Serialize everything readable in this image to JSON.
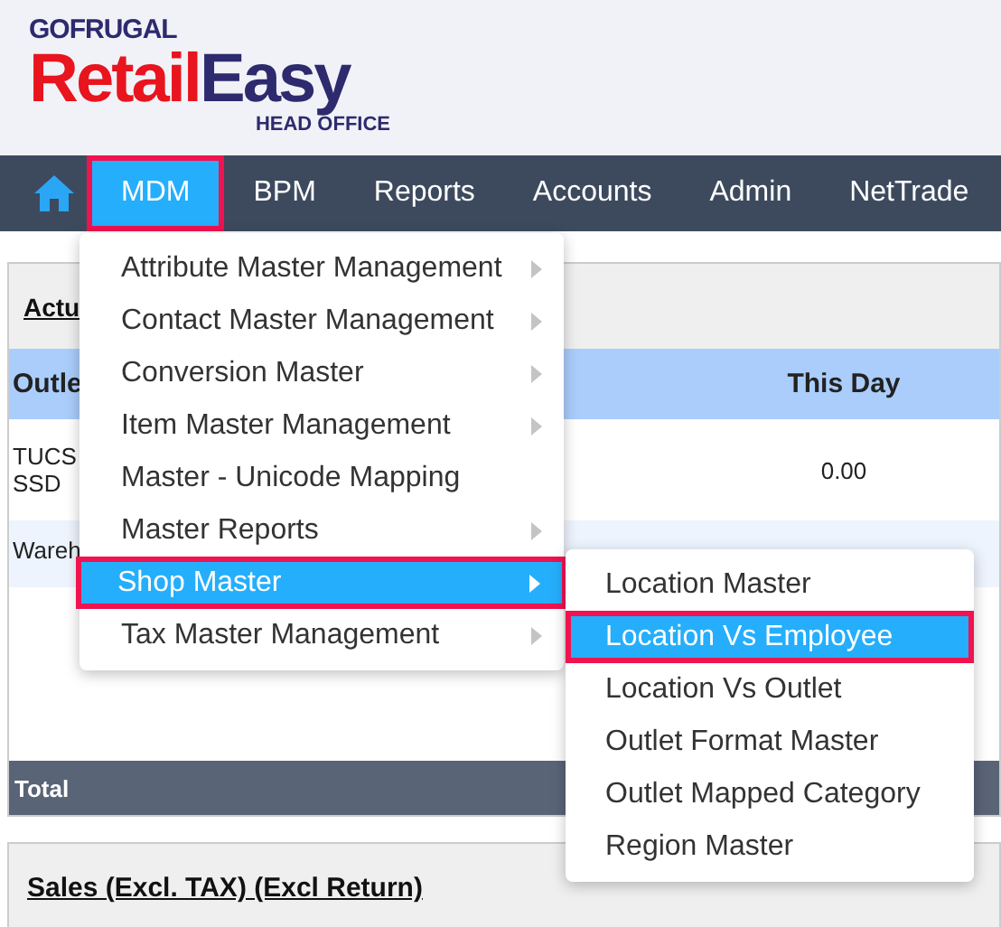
{
  "logo": {
    "brand": "GOFRUGAL",
    "name_part_1": "Retail",
    "name_part_2": "Easy",
    "tagline": "HEAD OFFICE"
  },
  "nav": [
    {
      "label": "MDM",
      "selected": true,
      "outlined": true
    },
    {
      "label": "BPM",
      "selected": false,
      "outlined": false
    },
    {
      "label": "Reports",
      "selected": false,
      "outlined": false
    },
    {
      "label": "Accounts",
      "selected": false,
      "outlined": false
    },
    {
      "label": "Admin",
      "selected": false,
      "outlined": false
    },
    {
      "label": "NetTrade",
      "selected": false,
      "outlined": false
    }
  ],
  "panel": {
    "title": "Actu",
    "columns": [
      "Outle",
      "This Day"
    ],
    "rows": [
      {
        "cells": [
          "TUCS\nSSD",
          "0.00"
        ]
      },
      {
        "cells": [
          "Wareh"
        ]
      }
    ],
    "total_label": "Total"
  },
  "panel_2": {
    "title": "Sales (Excl. TAX) (Excl Return)"
  },
  "menu": [
    {
      "label": "Attribute Master Management",
      "has_submenu": true,
      "selected": false,
      "outlined": false
    },
    {
      "label": "Contact Master Management",
      "has_submenu": true,
      "selected": false,
      "outlined": false
    },
    {
      "label": "Conversion Master",
      "has_submenu": true,
      "selected": false,
      "outlined": false
    },
    {
      "label": "Item Master Management",
      "has_submenu": true,
      "selected": false,
      "outlined": false
    },
    {
      "label": "Master - Unicode Mapping",
      "has_submenu": false,
      "selected": false,
      "outlined": false
    },
    {
      "label": "Master Reports",
      "has_submenu": true,
      "selected": false,
      "outlined": false
    },
    {
      "label": "Shop Master",
      "has_submenu": true,
      "selected": true,
      "outlined": true
    },
    {
      "label": "Tax Master Management",
      "has_submenu": true,
      "selected": false,
      "outlined": false
    }
  ],
  "submenu": [
    {
      "label": "Location Master",
      "selected": false,
      "outlined": false
    },
    {
      "label": "Location Vs Employee",
      "selected": true,
      "outlined": true
    },
    {
      "label": "Location Vs Outlet",
      "selected": false,
      "outlined": false
    },
    {
      "label": "Outlet Format Master",
      "selected": false,
      "outlined": false
    },
    {
      "label": "Outlet Mapped Category",
      "selected": false,
      "outlined": false
    },
    {
      "label": "Region Master",
      "selected": false,
      "outlined": false
    }
  ]
}
